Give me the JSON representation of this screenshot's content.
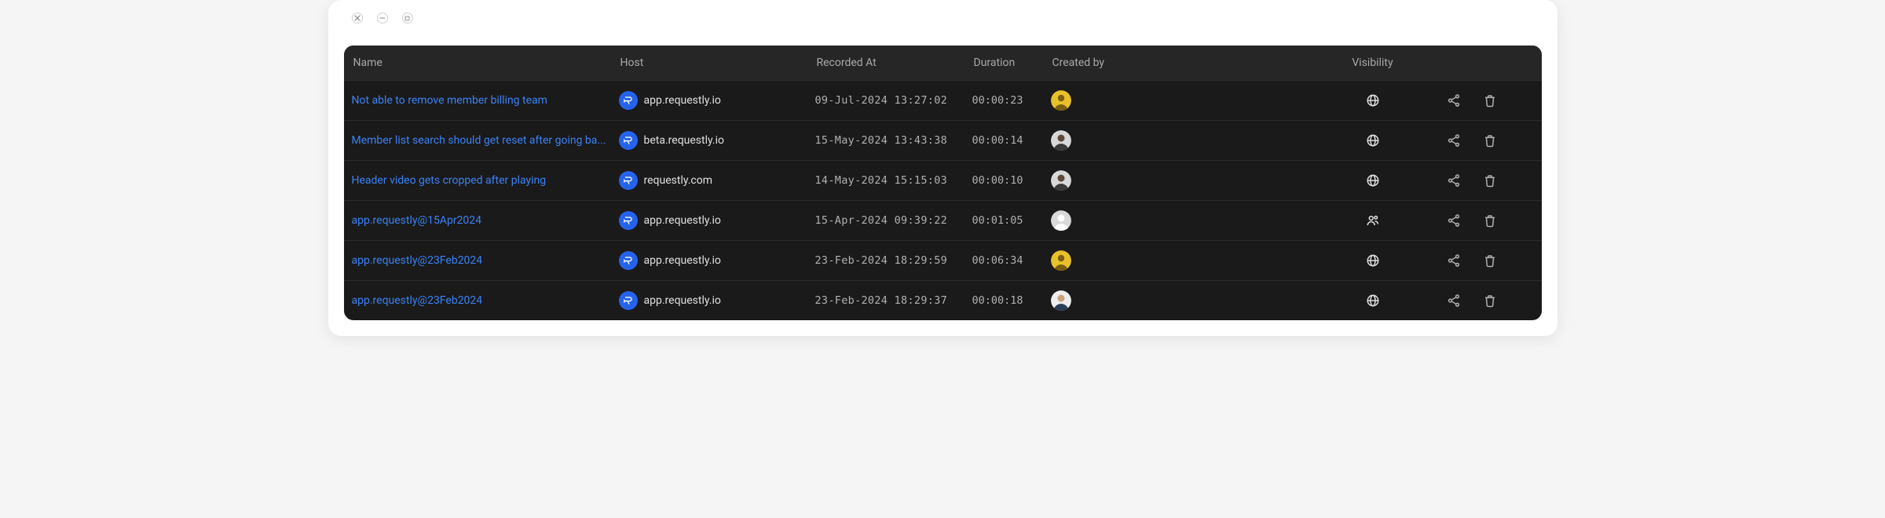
{
  "columns": {
    "name": "Name",
    "host": "Host",
    "recorded_at": "Recorded At",
    "duration": "Duration",
    "created_by": "Created by",
    "visibility": "Visibility"
  },
  "rows": [
    {
      "name": "Not able to remove member billing team",
      "host": "app.requestly.io",
      "recorded_at": "09-Jul-2024 13:27:02",
      "duration": "00:00:23",
      "avatar": "yellow",
      "visibility": "public"
    },
    {
      "name": "Member list search should get reset after going ba...",
      "host": "beta.requestly.io",
      "recorded_at": "15-May-2024 13:43:38",
      "duration": "00:00:14",
      "avatar": "person1",
      "visibility": "public"
    },
    {
      "name": "Header video gets cropped after playing",
      "host": "requestly.com",
      "recorded_at": "14-May-2024 15:15:03",
      "duration": "00:00:10",
      "avatar": "person1",
      "visibility": "public"
    },
    {
      "name": "app.requestly@15Apr2024",
      "host": "app.requestly.io",
      "recorded_at": "15-Apr-2024 09:39:22",
      "duration": "00:01:05",
      "avatar": "blank",
      "visibility": "team"
    },
    {
      "name": "app.requestly@23Feb2024",
      "host": "app.requestly.io",
      "recorded_at": "23-Feb-2024 18:29:59",
      "duration": "00:06:34",
      "avatar": "yellow",
      "visibility": "public"
    },
    {
      "name": "app.requestly@23Feb2024",
      "host": "app.requestly.io",
      "recorded_at": "23-Feb-2024 18:29:37",
      "duration": "00:00:18",
      "avatar": "person2",
      "visibility": "public"
    }
  ]
}
